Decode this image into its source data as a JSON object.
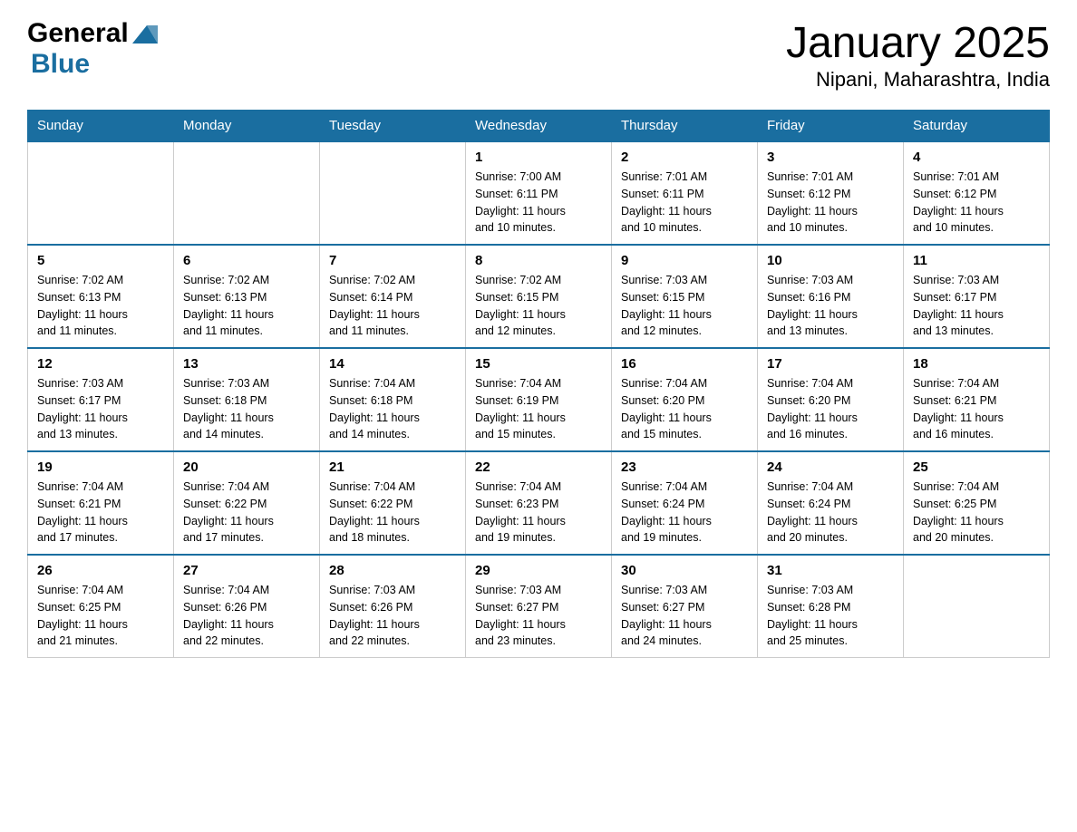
{
  "header": {
    "logo_general": "General",
    "logo_blue": "Blue",
    "title": "January 2025",
    "subtitle": "Nipani, Maharashtra, India"
  },
  "calendar": {
    "days": [
      "Sunday",
      "Monday",
      "Tuesday",
      "Wednesday",
      "Thursday",
      "Friday",
      "Saturday"
    ],
    "weeks": [
      [
        {
          "date": "",
          "info": ""
        },
        {
          "date": "",
          "info": ""
        },
        {
          "date": "",
          "info": ""
        },
        {
          "date": "1",
          "info": "Sunrise: 7:00 AM\nSunset: 6:11 PM\nDaylight: 11 hours\nand 10 minutes."
        },
        {
          "date": "2",
          "info": "Sunrise: 7:01 AM\nSunset: 6:11 PM\nDaylight: 11 hours\nand 10 minutes."
        },
        {
          "date": "3",
          "info": "Sunrise: 7:01 AM\nSunset: 6:12 PM\nDaylight: 11 hours\nand 10 minutes."
        },
        {
          "date": "4",
          "info": "Sunrise: 7:01 AM\nSunset: 6:12 PM\nDaylight: 11 hours\nand 10 minutes."
        }
      ],
      [
        {
          "date": "5",
          "info": "Sunrise: 7:02 AM\nSunset: 6:13 PM\nDaylight: 11 hours\nand 11 minutes."
        },
        {
          "date": "6",
          "info": "Sunrise: 7:02 AM\nSunset: 6:13 PM\nDaylight: 11 hours\nand 11 minutes."
        },
        {
          "date": "7",
          "info": "Sunrise: 7:02 AM\nSunset: 6:14 PM\nDaylight: 11 hours\nand 11 minutes."
        },
        {
          "date": "8",
          "info": "Sunrise: 7:02 AM\nSunset: 6:15 PM\nDaylight: 11 hours\nand 12 minutes."
        },
        {
          "date": "9",
          "info": "Sunrise: 7:03 AM\nSunset: 6:15 PM\nDaylight: 11 hours\nand 12 minutes."
        },
        {
          "date": "10",
          "info": "Sunrise: 7:03 AM\nSunset: 6:16 PM\nDaylight: 11 hours\nand 13 minutes."
        },
        {
          "date": "11",
          "info": "Sunrise: 7:03 AM\nSunset: 6:17 PM\nDaylight: 11 hours\nand 13 minutes."
        }
      ],
      [
        {
          "date": "12",
          "info": "Sunrise: 7:03 AM\nSunset: 6:17 PM\nDaylight: 11 hours\nand 13 minutes."
        },
        {
          "date": "13",
          "info": "Sunrise: 7:03 AM\nSunset: 6:18 PM\nDaylight: 11 hours\nand 14 minutes."
        },
        {
          "date": "14",
          "info": "Sunrise: 7:04 AM\nSunset: 6:18 PM\nDaylight: 11 hours\nand 14 minutes."
        },
        {
          "date": "15",
          "info": "Sunrise: 7:04 AM\nSunset: 6:19 PM\nDaylight: 11 hours\nand 15 minutes."
        },
        {
          "date": "16",
          "info": "Sunrise: 7:04 AM\nSunset: 6:20 PM\nDaylight: 11 hours\nand 15 minutes."
        },
        {
          "date": "17",
          "info": "Sunrise: 7:04 AM\nSunset: 6:20 PM\nDaylight: 11 hours\nand 16 minutes."
        },
        {
          "date": "18",
          "info": "Sunrise: 7:04 AM\nSunset: 6:21 PM\nDaylight: 11 hours\nand 16 minutes."
        }
      ],
      [
        {
          "date": "19",
          "info": "Sunrise: 7:04 AM\nSunset: 6:21 PM\nDaylight: 11 hours\nand 17 minutes."
        },
        {
          "date": "20",
          "info": "Sunrise: 7:04 AM\nSunset: 6:22 PM\nDaylight: 11 hours\nand 17 minutes."
        },
        {
          "date": "21",
          "info": "Sunrise: 7:04 AM\nSunset: 6:22 PM\nDaylight: 11 hours\nand 18 minutes."
        },
        {
          "date": "22",
          "info": "Sunrise: 7:04 AM\nSunset: 6:23 PM\nDaylight: 11 hours\nand 19 minutes."
        },
        {
          "date": "23",
          "info": "Sunrise: 7:04 AM\nSunset: 6:24 PM\nDaylight: 11 hours\nand 19 minutes."
        },
        {
          "date": "24",
          "info": "Sunrise: 7:04 AM\nSunset: 6:24 PM\nDaylight: 11 hours\nand 20 minutes."
        },
        {
          "date": "25",
          "info": "Sunrise: 7:04 AM\nSunset: 6:25 PM\nDaylight: 11 hours\nand 20 minutes."
        }
      ],
      [
        {
          "date": "26",
          "info": "Sunrise: 7:04 AM\nSunset: 6:25 PM\nDaylight: 11 hours\nand 21 minutes."
        },
        {
          "date": "27",
          "info": "Sunrise: 7:04 AM\nSunset: 6:26 PM\nDaylight: 11 hours\nand 22 minutes."
        },
        {
          "date": "28",
          "info": "Sunrise: 7:03 AM\nSunset: 6:26 PM\nDaylight: 11 hours\nand 22 minutes."
        },
        {
          "date": "29",
          "info": "Sunrise: 7:03 AM\nSunset: 6:27 PM\nDaylight: 11 hours\nand 23 minutes."
        },
        {
          "date": "30",
          "info": "Sunrise: 7:03 AM\nSunset: 6:27 PM\nDaylight: 11 hours\nand 24 minutes."
        },
        {
          "date": "31",
          "info": "Sunrise: 7:03 AM\nSunset: 6:28 PM\nDaylight: 11 hours\nand 25 minutes."
        },
        {
          "date": "",
          "info": ""
        }
      ]
    ]
  }
}
